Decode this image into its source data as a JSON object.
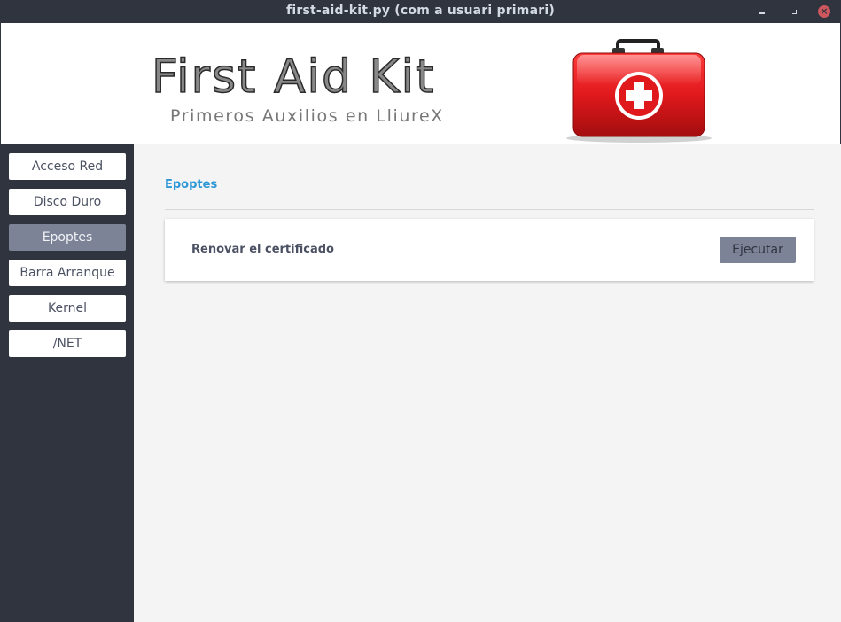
{
  "window": {
    "title": "first-aid-kit.py (com a usuari primari)",
    "close_glyph": "×"
  },
  "banner": {
    "title": "First Aid Kit",
    "subtitle": "Primeros Auxilios en LliureX",
    "logo_icon": "first-aid-kit-icon"
  },
  "sidebar": {
    "items": [
      {
        "label": "Acceso Red",
        "active": false
      },
      {
        "label": "Disco Duro",
        "active": false
      },
      {
        "label": "Epoptes",
        "active": true
      },
      {
        "label": "Barra Arranque",
        "active": false
      },
      {
        "label": "Kernel",
        "active": false
      },
      {
        "label": "/NET",
        "active": false
      }
    ]
  },
  "main": {
    "section_title": "Epoptes",
    "card": {
      "label": "Renovar el certificado",
      "button_label": "Ejecutar"
    }
  },
  "colors": {
    "window_bg": "#2f343f",
    "accent": "#2e97d6",
    "active_item": "#7c8397",
    "kit_red": "#e0191c"
  }
}
